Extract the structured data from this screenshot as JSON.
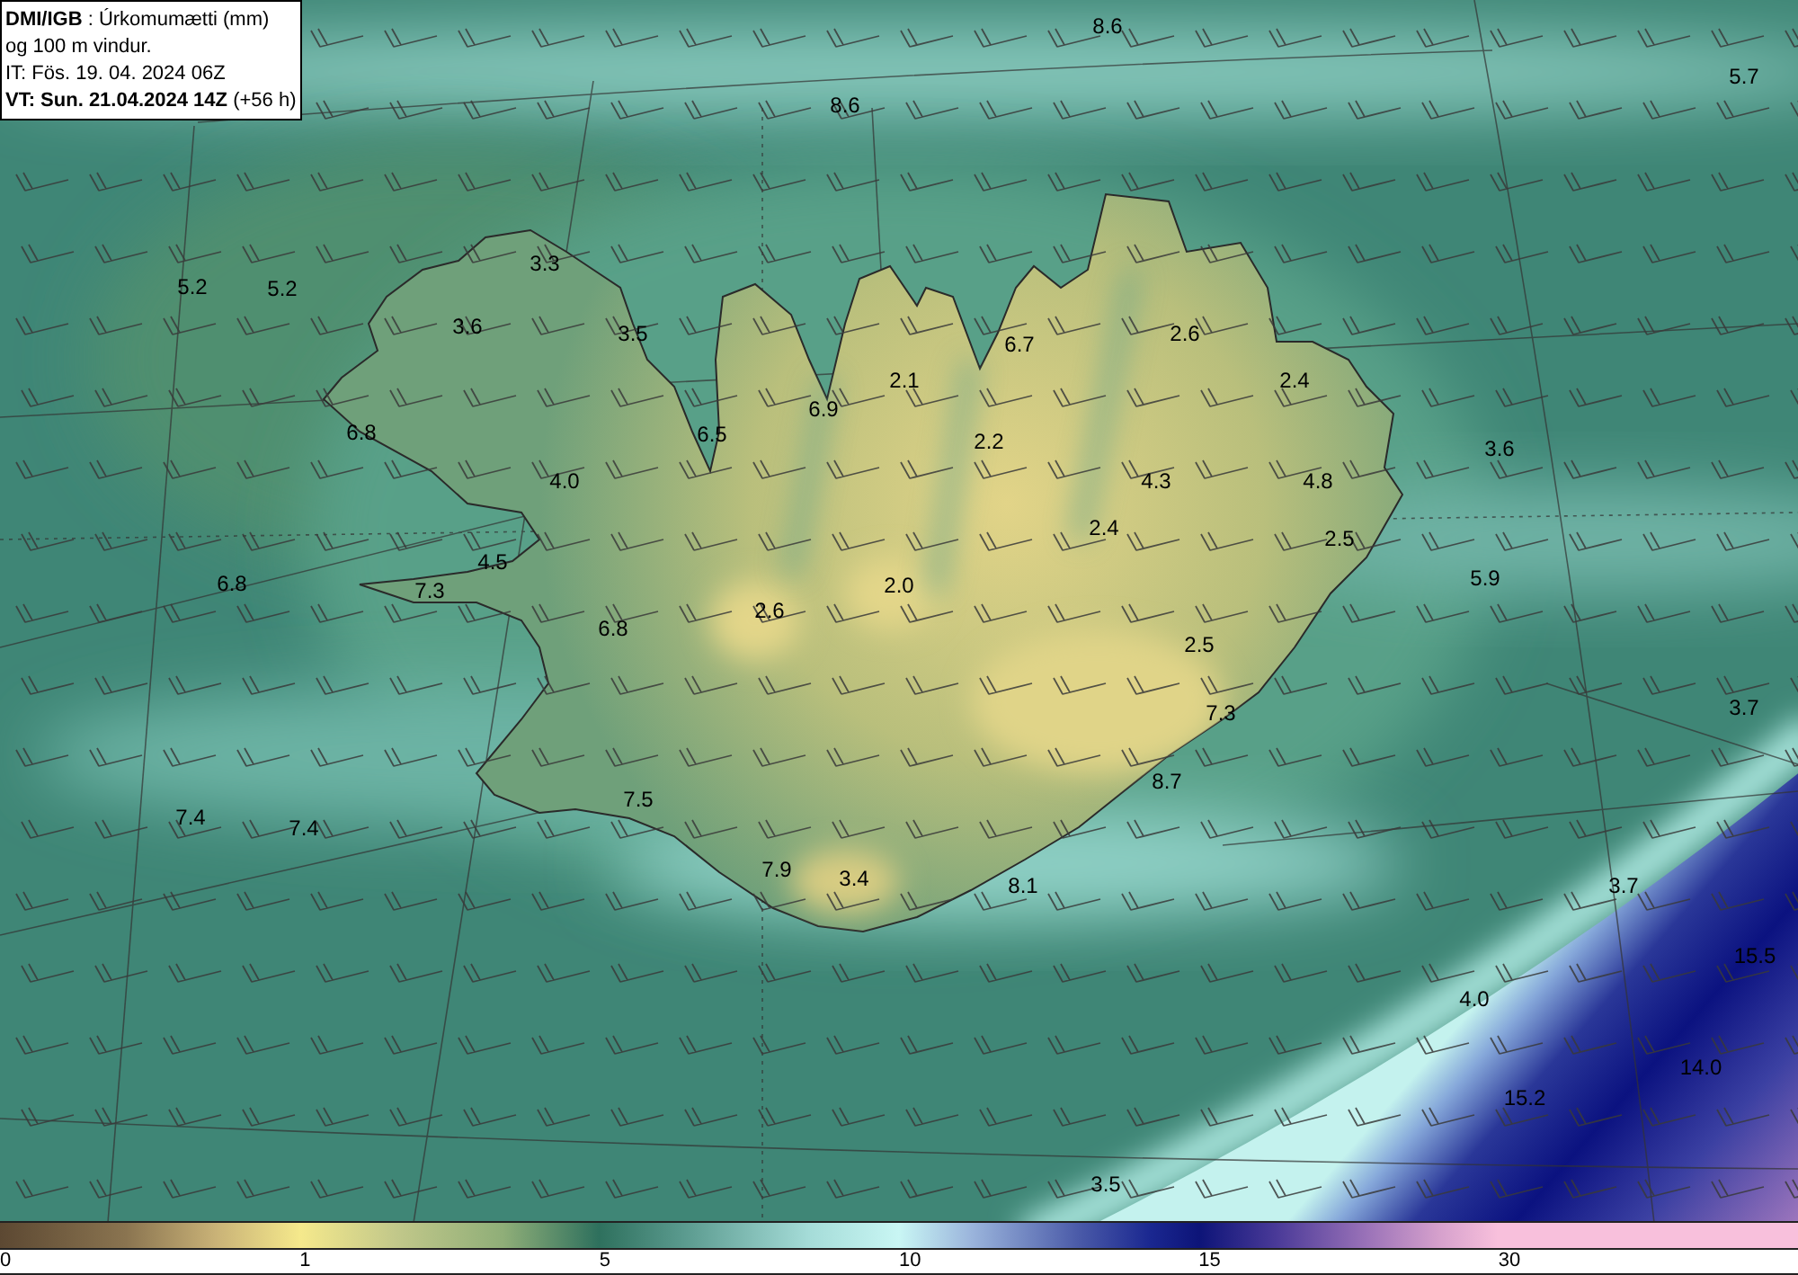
{
  "legend": {
    "lines": [
      "**DMI/IGB** : Úrkomumætti (mm)",
      "og 100 m vindur.",
      "IT: Fös. 19. 04. 2024 06Z",
      "**VT: Sun. 21.04.2024 14Z** (+56 h)"
    ]
  },
  "map": {
    "values": [
      "8.6",
      "5.7",
      "8.6",
      "3.3",
      "5.2",
      "5.2",
      "3.6",
      "3.5",
      "6.7",
      "2.6",
      "2.1",
      "2.4",
      "6.9",
      "6.8",
      "6.5",
      "2.2",
      "3.6",
      "4.0",
      "4.3",
      "4.8",
      "2.4",
      "2.5",
      "4.5",
      "6.8",
      "7.3",
      "2.0",
      "5.9",
      "2.6",
      "6.8",
      "2.5",
      "7.3",
      "3.7",
      "8.7",
      "7.5",
      "7.4",
      "7.4",
      "7.9",
      "3.4",
      "8.1",
      "3.7",
      "15.5",
      "4.0",
      "14.0",
      "15.2",
      "3.5"
    ]
  },
  "color_scale": {
    "ticks": [
      "0",
      "1",
      "5",
      "10",
      "15",
      "30"
    ]
  }
}
